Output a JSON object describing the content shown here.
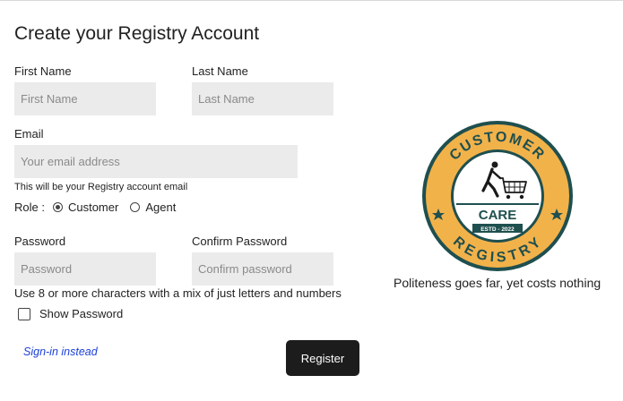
{
  "form": {
    "title": "Create your Registry Account",
    "first_name": {
      "label": "First Name",
      "placeholder": "First Name",
      "value": ""
    },
    "last_name": {
      "label": "Last Name",
      "placeholder": "Last Name",
      "value": ""
    },
    "email": {
      "label": "Email",
      "placeholder": "Your email address",
      "value": "",
      "hint": "This will be your Registry account email"
    },
    "role": {
      "label": "Role :",
      "options": [
        "Customer",
        "Agent"
      ],
      "selected": "Customer"
    },
    "password": {
      "label": "Password",
      "placeholder": "Password",
      "value": ""
    },
    "confirm_password": {
      "label": "Confirm Password",
      "placeholder": "Confirm password",
      "value": ""
    },
    "password_hint": "Use 8 or more characters with a mix of just letters and numbers",
    "show_password": {
      "label": "Show Password",
      "checked": false
    },
    "signin_link": "Sign-in instead",
    "register_button": "Register"
  },
  "logo": {
    "top_text": "CUSTOMER",
    "middle_text": "CARE",
    "estd_text": "ESTD - 2022",
    "bottom_text": "REGISTRY",
    "icon": "shopping-cart-person-icon",
    "colors": {
      "ring": "#1f4f4f",
      "gold": "#f2b24a",
      "dark": "#1a1a1a"
    }
  },
  "tagline": "Politeness goes far, yet costs nothing"
}
